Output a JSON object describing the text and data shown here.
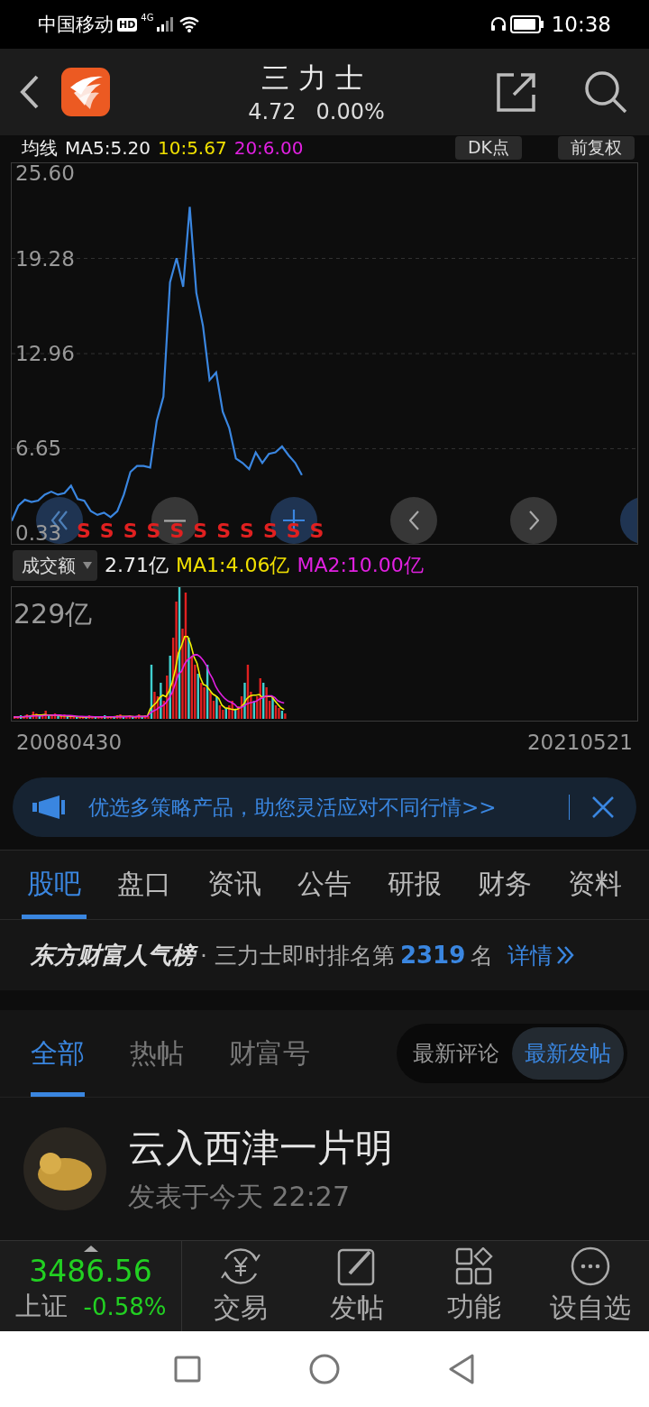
{
  "status_bar": {
    "carrier": "中国移动",
    "hd": "HD",
    "network": "4G",
    "time": "10:38"
  },
  "header": {
    "title": "三力士",
    "price": "4.72",
    "change": "0.00%"
  },
  "ma_bar": {
    "label": "均线",
    "ma5": "MA5:5.20",
    "ma10": "10:5.67",
    "ma20": "20:6.00",
    "buttons": [
      "DK点",
      "前复权"
    ]
  },
  "price_chart": {
    "chart_data": {
      "type": "line",
      "ylim": [
        0.33,
        25.6
      ],
      "grid": true,
      "yticks": [
        {
          "value": 0.33,
          "label": "0.33"
        },
        {
          "value": 6.65,
          "label": "6.65"
        },
        {
          "value": 12.96,
          "label": "12.96"
        },
        {
          "value": 19.28,
          "label": "19.28"
        },
        {
          "value": 25.6,
          "label": "25.60"
        }
      ],
      "series": [
        {
          "color": "#3a86e0",
          "values": [
            1.85,
            2.86,
            3.26,
            3.11,
            3.2,
            3.6,
            3.8,
            3.6,
            3.7,
            4.2,
            3.3,
            3.2,
            2.5,
            2.25,
            2.4,
            2.1,
            2.5,
            3.6,
            5.1,
            5.5,
            5.5,
            5.4,
            8.5,
            10.1,
            17.7,
            19.3,
            17.4,
            22.7,
            17.0,
            14.8,
            11.2,
            11.7,
            9.1,
            8.0,
            6.0,
            5.7,
            5.3,
            6.4,
            5.7,
            6.3,
            6.4,
            6.8,
            6.2,
            5.7,
            4.9,
            null,
            null,
            null,
            null,
            null,
            null,
            null,
            null,
            null,
            null,
            null,
            null,
            null,
            null,
            null,
            null,
            null,
            null,
            null,
            null,
            null,
            null,
            null,
            null,
            null,
            null,
            null,
            null,
            null,
            null,
            null,
            null,
            null,
            null,
            null,
            null,
            null,
            null,
            null,
            null,
            null,
            null,
            null,
            null,
            null,
            null,
            null,
            null,
            null,
            null,
            null
          ]
        }
      ]
    },
    "sell_marks": [
      "S",
      "S",
      "S",
      "S",
      "S",
      "S",
      "S",
      "S",
      "S",
      "S",
      "S"
    ]
  },
  "volume": {
    "selector": "成交额",
    "value": "2.71亿",
    "ma1": "MA1:4.06亿",
    "ma2": "MA2:10.00亿",
    "max_label": "229亿"
  },
  "date_range": {
    "start": "20080430",
    "end": "20210521"
  },
  "banner": {
    "text": "优选多策略产品，助您灵活应对不同行情>>"
  },
  "tabs": [
    {
      "label": "股吧",
      "selected": true
    },
    {
      "label": "盘口",
      "selected": false
    },
    {
      "label": "资讯",
      "selected": false
    },
    {
      "label": "公告",
      "selected": false
    },
    {
      "label": "研报",
      "selected": false
    },
    {
      "label": "财务",
      "selected": false
    },
    {
      "label": "资料",
      "selected": false
    }
  ],
  "ranking": {
    "brand": "东方财富人气榜",
    "text": "· 三力士即时排名第",
    "rank": "2319",
    "unit": "名",
    "link": "详情"
  },
  "filters": [
    {
      "label": "全部",
      "selected": true
    },
    {
      "label": "热帖",
      "selected": false
    },
    {
      "label": "财富号",
      "selected": false
    }
  ],
  "sort": [
    {
      "label": "最新评论",
      "selected": false
    },
    {
      "label": "最新发帖",
      "selected": true
    }
  ],
  "post": {
    "author": "云入西津一片明",
    "time": "发表于今天 22:27"
  },
  "bottom_bar": {
    "index": {
      "value": "3486.56",
      "name": "上证",
      "change": "-0.58%"
    },
    "items": [
      {
        "label": "交易",
        "kind": "trade"
      },
      {
        "label": "发帖",
        "kind": "post"
      },
      {
        "label": "功能",
        "kind": "apps"
      },
      {
        "label": "设自选",
        "kind": "more"
      }
    ]
  }
}
